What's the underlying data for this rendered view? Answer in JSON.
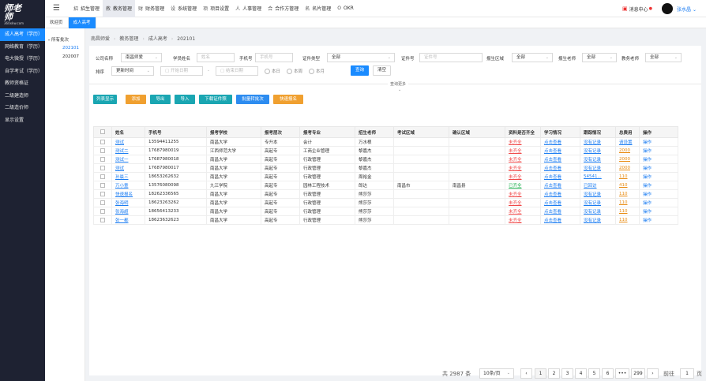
{
  "logo": {
    "big": "师老师",
    "small": "360xkw.com"
  },
  "sidebar": {
    "items": [
      {
        "label": "成人高考（学历）",
        "active": true
      },
      {
        "label": "网络教育（学历）"
      },
      {
        "label": "电大微授（学历）"
      },
      {
        "label": "自学考试（学历）"
      },
      {
        "label": "教师资格证"
      },
      {
        "label": "二级建造师"
      },
      {
        "label": "二级造价师"
      },
      {
        "label": "显示设置"
      }
    ]
  },
  "topmenu": [
    {
      "icon": "招",
      "label": "招生管理"
    },
    {
      "icon": "教",
      "label": "教务管理",
      "active": true
    },
    {
      "icon": "财",
      "label": "财务管理"
    },
    {
      "icon": "设",
      "label": "系统管理"
    },
    {
      "icon": "项",
      "label": "项目设置"
    },
    {
      "icon": "人",
      "label": "人事管理"
    },
    {
      "icon": "合",
      "label": "合作方管理"
    },
    {
      "icon": "名",
      "label": "名片管理"
    },
    {
      "icon": "O",
      "label": "OKR"
    }
  ],
  "header": {
    "messages": "消息中心",
    "username": "张水晶"
  },
  "tabs": [
    {
      "label": "欢迎页"
    },
    {
      "label": "成人高考",
      "active": true
    }
  ],
  "batches": {
    "root": "所有批次",
    "items": [
      {
        "label": "202101",
        "active": true
      },
      {
        "label": "202007"
      }
    ]
  },
  "breadcrumb": [
    "南昌师爱",
    "教务管理",
    "成人高考",
    "202101"
  ],
  "filters": {
    "company_label": "公司名称",
    "company_value": "南昌师爱",
    "student_label": "学员姓名",
    "student_ph": "姓名",
    "phone_label": "手机号",
    "phone_ph": "手机号",
    "idtype_label": "证件类型",
    "idtype_value": "全部",
    "idno_label": "证件号",
    "idno_ph": "证件号",
    "region_label": "报生区域",
    "region_value": "全部",
    "teacher_label": "报生老师",
    "teacher_value": "全部",
    "eduteacher_label": "教务老师",
    "eduteacher_value": "全部",
    "sort_label": "排序",
    "sort_value": "更新时间",
    "start_ph": "开始日期",
    "dash": "-",
    "end_ph": "结束日期",
    "radios": [
      "本日",
      "本周",
      "本月"
    ],
    "query": "查询",
    "reset": "清空",
    "more": "查询更多"
  },
  "actions": [
    {
      "label": "列表显示",
      "color": "#1aa6b2"
    },
    {
      "label": "添加",
      "color": "#f0a030"
    },
    {
      "label": "导出",
      "color": "#1aa6b2"
    },
    {
      "label": "导入",
      "color": "#1aa6b2"
    },
    {
      "label": "下载证件照",
      "color": "#1aa6b2"
    },
    {
      "label": "批量转批次",
      "color": "#2d8cf0"
    },
    {
      "label": "快速报名",
      "color": "#f0a030"
    }
  ],
  "table": {
    "columns": [
      "姓名",
      "手机号",
      "报考学校",
      "报考层次",
      "报考专业",
      "招生老师",
      "考试区域",
      "确认区域",
      "资料是否齐全",
      "学习情况",
      "跟踪情况",
      "总费用",
      "操作"
    ],
    "rows": [
      {
        "name": "测试",
        "phone": "13594411255",
        "school": "南昌大学",
        "level": "专升本",
        "major": "会计",
        "teacher": "万水根",
        "exam": "",
        "confirm": "",
        "docs": "未齐全",
        "docs_ok": false,
        "study": "点击查看",
        "track": "没有记录",
        "fee": "请设置",
        "fee_style": "blue",
        "op": "操作"
      },
      {
        "name": "测试二",
        "phone": "17687980019",
        "school": "江西师范大学",
        "level": "高起专",
        "major": "工商企业管理",
        "teacher": "黎嘉杰",
        "exam": "",
        "confirm": "",
        "docs": "未齐全",
        "docs_ok": false,
        "study": "点击查看",
        "track": "没有记录",
        "fee": "2000",
        "fee_style": "orange",
        "op": "操作"
      },
      {
        "name": "测试一",
        "phone": "17687980018",
        "school": "南昌大学",
        "level": "高起专",
        "major": "行政管理",
        "teacher": "黎嘉杰",
        "exam": "",
        "confirm": "",
        "docs": "未齐全",
        "docs_ok": false,
        "study": "点击查看",
        "track": "没有记录",
        "fee": "2000",
        "fee_style": "orange",
        "op": "操作"
      },
      {
        "name": "测试",
        "phone": "17687980017",
        "school": "南昌大学",
        "level": "高起专",
        "major": "行政管理",
        "teacher": "黎嘉杰",
        "exam": "",
        "confirm": "",
        "docs": "未齐全",
        "docs_ok": false,
        "study": "点击查看",
        "track": "没有记录",
        "fee": "2000",
        "fee_style": "orange",
        "op": "操作"
      },
      {
        "name": "孙晨三",
        "phone": "18653262632",
        "school": "南昌大学",
        "level": "高起专",
        "major": "行政管理",
        "teacher": "周裕金",
        "exam": "",
        "confirm": "",
        "docs": "未齐全",
        "docs_ok": false,
        "study": "点击查看",
        "track": "54541...",
        "fee": "110",
        "fee_style": "orange",
        "op": "操作"
      },
      {
        "name": "万小童",
        "phone": "13576080098",
        "school": "九江学院",
        "level": "高起专",
        "major": "园林工程技术",
        "teacher": "郎达",
        "exam": "南昌市",
        "confirm": "南昌县",
        "docs": "已齐全",
        "docs_ok": true,
        "study": "点击查看",
        "track": "已回访",
        "fee": "410",
        "fee_style": "orange",
        "op": "操作"
      },
      {
        "name": "快速报名",
        "phone": "18262336565",
        "school": "南昌大学",
        "level": "高起专",
        "major": "行政管理",
        "teacher": "熊莎莎",
        "exam": "",
        "confirm": "",
        "docs": "未齐全",
        "docs_ok": false,
        "study": "点击查看",
        "track": "没有记录",
        "fee": "110",
        "fee_style": "orange",
        "op": "操作"
      },
      {
        "name": "张海明",
        "phone": "18623263262",
        "school": "南昌大学",
        "level": "高起专",
        "major": "行政管理",
        "teacher": "熊莎莎",
        "exam": "",
        "confirm": "",
        "docs": "未齐全",
        "docs_ok": false,
        "study": "点击查看",
        "track": "没有记录",
        "fee": "110",
        "fee_style": "orange",
        "op": "操作"
      },
      {
        "name": "张海超",
        "phone": "18656413233",
        "school": "南昌大学",
        "level": "高起专",
        "major": "行政管理",
        "teacher": "熊莎莎",
        "exam": "",
        "confirm": "",
        "docs": "未齐全",
        "docs_ok": false,
        "study": "点击查看",
        "track": "没有记录",
        "fee": "110",
        "fee_style": "orange",
        "op": "操作"
      },
      {
        "name": "张一都",
        "phone": "18623632623",
        "school": "南昌大学",
        "level": "高起专",
        "major": "行政管理",
        "teacher": "熊莎莎",
        "exam": "",
        "confirm": "",
        "docs": "未齐全",
        "docs_ok": false,
        "study": "点击查看",
        "track": "没有记录",
        "fee": "110",
        "fee_style": "orange",
        "op": "操作"
      }
    ]
  },
  "pager": {
    "total": "共 2987 条",
    "size": "10条/页",
    "prev": "‹",
    "next": "›",
    "pages": [
      "1",
      "2",
      "3",
      "4",
      "5",
      "6",
      "•••",
      "299"
    ],
    "goto_label": "前往",
    "goto_value": "1",
    "goto_suffix": "页"
  }
}
